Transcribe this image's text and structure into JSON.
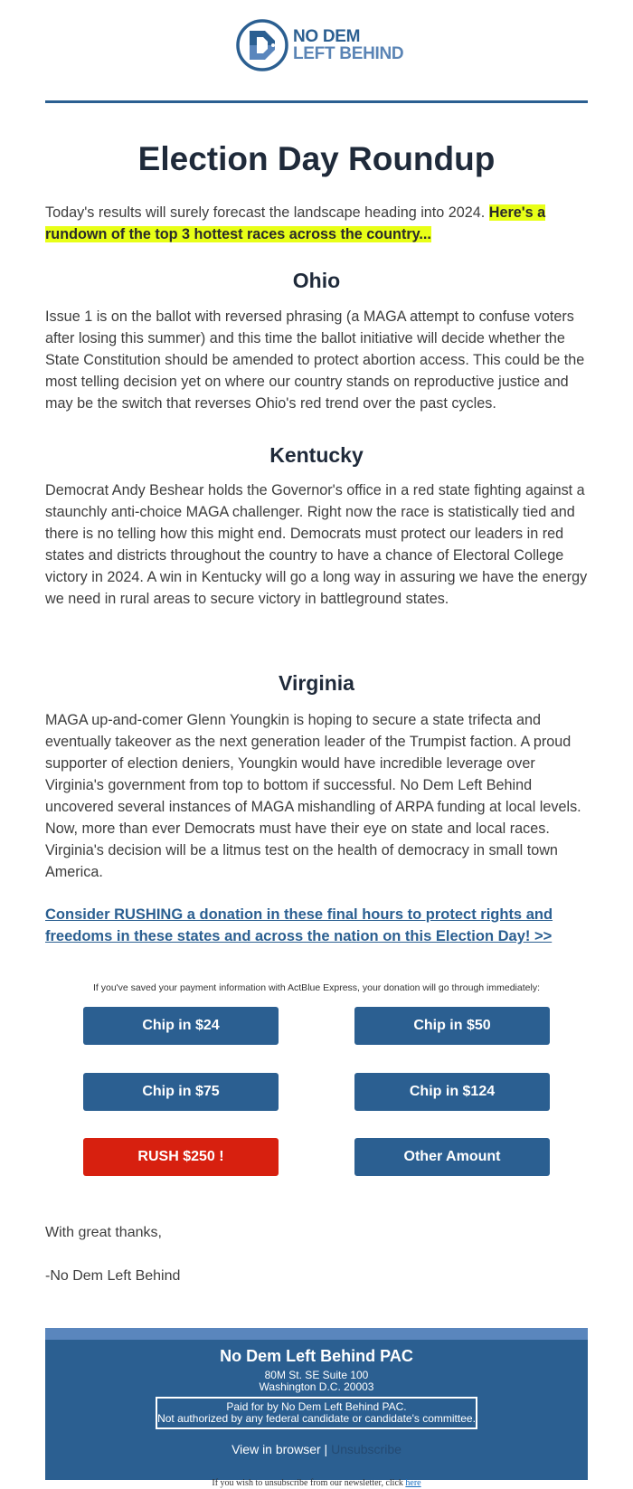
{
  "header": {
    "logo_line1": "NO DEM",
    "logo_line2": "LEFT BEHIND",
    "logo_icon": "d-circle-logo-icon"
  },
  "title": "Election Day Roundup",
  "intro": {
    "text": "Today's results will surely forecast the landscape heading into 2024. ",
    "highlight": "Here's a rundown of the top 3 hottest races across the country..."
  },
  "sections": [
    {
      "heading": "Ohio",
      "body": "Issue 1 is on the ballot with reversed phrasing (a MAGA attempt to confuse voters after losing this summer) and this time the ballot initiative will decide whether the State Constitution should be amended to protect abortion access. This could be the most telling decision yet on where our country stands on reproductive justice and may be the switch that reverses Ohio's red trend over the past cycles."
    },
    {
      "heading": "Kentucky",
      "body": "Democrat Andy Beshear holds the Governor's office in a red state fighting against a staunchly anti-choice MAGA challenger. Right now the race is statistically tied and there is no telling how this might end. Democrats must protect our leaders in red states and districts throughout the country to have a chance of Electoral College victory in 2024. A win in Kentucky will go a long way in assuring we have the energy we need in rural areas to secure victory in battleground states."
    },
    {
      "heading": "Virginia",
      "body": "MAGA up-and-comer Glenn Youngkin is hoping to secure a state trifecta and eventually takeover as the next generation leader of the Trumpist faction. A proud supporter of election deniers, Youngkin would have incredible leverage over Virginia's government from top to bottom if successful. No Dem Left Behind uncovered several instances of MAGA mishandling of ARPA funding at local levels. Now, more than ever Democrats must have their eye on state and local races. Virginia's decision will be a litmus test on the health of democracy in small town America."
    }
  ],
  "cta_link": "Consider RUSHING a donation in these final hours to protect rights and freedoms in these states and across the nation on this Election Day! >>",
  "express_note": "If you've saved your payment information with ActBlue Express, your donation will go through immediately:",
  "donate_buttons": [
    {
      "label": "Chip in $24",
      "color": "#2b5f91"
    },
    {
      "label": "Chip in $50",
      "color": "#2b5f91"
    },
    {
      "label": "Chip in $75",
      "color": "#2b5f91"
    },
    {
      "label": "Chip in $124",
      "color": "#2b5f91"
    },
    {
      "label": "RUSH $250 !",
      "color": "#d7200f"
    },
    {
      "label": "Other Amount",
      "color": "#2b5f91"
    }
  ],
  "signoff": {
    "line1": "With great thanks,",
    "line2": "-No Dem Left Behind"
  },
  "footer": {
    "org": "No Dem Left Behind PAC",
    "address1": "80M St. SE Suite 100",
    "address2": "Washington D.C. 20003",
    "disclaimer1": "Paid for by No Dem Left Behind PAC.",
    "disclaimer2": "Not authorized by any federal candidate or candidate's committee.",
    "view_in_browser": "View in browser",
    "separator": " | ",
    "unsubscribe": "Unsubscribe"
  },
  "bottom_note": {
    "text": "If you wish to unsubscribe from our newsletter, click ",
    "link": "here"
  },
  "colors": {
    "brand_blue": "#2b5f91",
    "brand_light_blue": "#5a86bd",
    "rush_red": "#d7200f",
    "highlight": "#e8ff17"
  }
}
